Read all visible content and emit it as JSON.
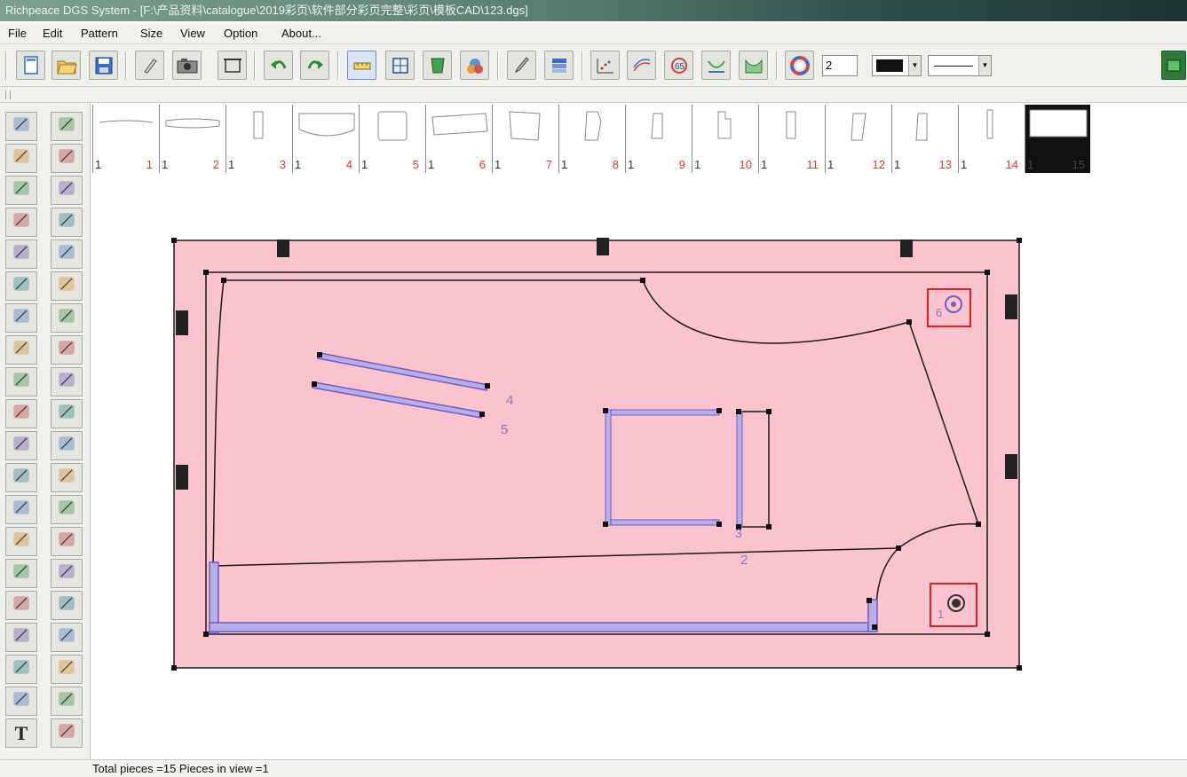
{
  "window": {
    "title": "Richpeace DGS System - [F:\\产品资料\\catalogue\\2019彩页\\软件部分彩页完整\\彩页\\模板CAD\\123.dgs]"
  },
  "menu": [
    "File",
    "Edit",
    "Pattern",
    "Size",
    "View",
    "Option",
    "About..."
  ],
  "toolbar": {
    "buttons": [
      "new-file-icon",
      "open-folder-icon",
      "save-icon",
      "edit-pen-icon",
      "camera-icon",
      "frame-icon",
      "undo-icon",
      "redo-icon",
      "measure-icon",
      "grid-icon",
      "piece-shape-icon",
      "palette-icon",
      "brush-icon",
      "stack-icon",
      "grade-points-icon",
      "grade-curve-icon",
      "grade-size-icon",
      "hem-curve-icon",
      "hem-fill-icon",
      "color-wheel-icon"
    ],
    "line_width_value": "2",
    "color_value": "#111111",
    "line_style_value": "solid"
  },
  "tools": {
    "left_column": [
      "select-arrow-icon",
      "pencil-icon",
      "rectangle-icon",
      "corner-ruler-icon",
      "intersect-icon",
      "measure-tape-icon",
      "compass-icon",
      "scissors-cut-icon",
      "marker-pen-icon",
      "dart-icon",
      "fold-icon",
      "flat-tool-icon",
      "mirror-icon",
      "spiral-icon",
      "chalk-icon",
      "note-icon",
      "scissors-icon",
      "stripe-icon",
      "comb-icon",
      "text-icon"
    ],
    "right_column": [
      "piece-select-icon",
      "pocket-icon",
      "move-piece-icon",
      "sleeve-icon",
      "piece-edit-icon",
      "length-icon",
      "button-icon",
      "texture-icon",
      "triangle-grade-icon",
      "sewing-machine-icon",
      "drawer-icon",
      "pour-icon",
      "bag-icon",
      "rotate-icon",
      "quad-icon",
      "bottle-icon",
      "shirt-pair-icon",
      "brush-stack-icon",
      "bell-icon",
      "layout-icon"
    ],
    "text_glyph": "T"
  },
  "pieces": [
    {
      "left": "1",
      "right": "1"
    },
    {
      "left": "1",
      "right": "2"
    },
    {
      "left": "1",
      "right": "3"
    },
    {
      "left": "1",
      "right": "4"
    },
    {
      "left": "1",
      "right": "5"
    },
    {
      "left": "1",
      "right": "6"
    },
    {
      "left": "1",
      "right": "7"
    },
    {
      "left": "1",
      "right": "8"
    },
    {
      "left": "1",
      "right": "9"
    },
    {
      "left": "1",
      "right": "10"
    },
    {
      "left": "1",
      "right": "11"
    },
    {
      "left": "1",
      "right": "12"
    },
    {
      "left": "1",
      "right": "13"
    },
    {
      "left": "1",
      "right": "14"
    },
    {
      "left": "1",
      "right": "15"
    }
  ],
  "canvas": {
    "labels": {
      "l4": "4",
      "l5": "5",
      "l3": "3",
      "l2": "2",
      "l6": "6",
      "l1": "1"
    },
    "colors": {
      "sheet": "#fbc3cd",
      "outline": "#1a1a1a",
      "sewing": "#6b5fc2",
      "sewing_fill": "#b6aee8",
      "label": "#8a78c4",
      "highlight": "#e02020"
    }
  },
  "status": {
    "text": "Total pieces =15    Pieces in view =1"
  }
}
